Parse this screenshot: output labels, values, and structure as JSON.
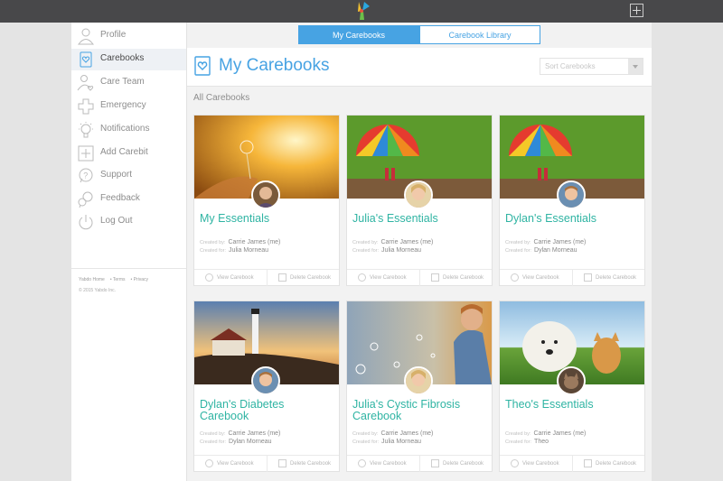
{
  "nav": [
    {
      "label": "Profile",
      "icon": "person-icon"
    },
    {
      "label": "Carebooks",
      "icon": "carebook-icon",
      "active": true
    },
    {
      "label": "Care Team",
      "icon": "care-team-icon"
    },
    {
      "label": "Emergency",
      "icon": "emergency-cross-icon"
    },
    {
      "label": "Notifications",
      "icon": "lightbulb-icon"
    },
    {
      "label": "Add Carebit",
      "icon": "plus-square-icon"
    },
    {
      "label": "Support",
      "icon": "question-bubble-icon"
    },
    {
      "label": "Feedback",
      "icon": "feedback-bubble-icon"
    },
    {
      "label": "Log Out",
      "icon": "power-icon"
    }
  ],
  "footer": {
    "links": [
      "Yabdo Home",
      "Terms",
      "Privacy"
    ],
    "copyright": "© 2015 Yabdo Inc."
  },
  "tabs": [
    "My Carebooks",
    "Carebook Library"
  ],
  "page_title": "My Carebooks",
  "sort": {
    "placeholder": "Sort Carebooks"
  },
  "section_title": "All Carebooks",
  "labels": {
    "created_by": "Created by:",
    "created_for": "Created for:",
    "view": "View Carebook",
    "delete": "Delete Carebook"
  },
  "cards": [
    {
      "title": "My Essentials",
      "created_by": "Carrie James (me)",
      "created_for": "Julia Morneau",
      "image": "dandelion-sunset"
    },
    {
      "title": "Julia's Essentials",
      "created_by": "Carrie James (me)",
      "created_for": "Julia Morneau",
      "image": "child-umbrella"
    },
    {
      "title": "Dylan's Essentials",
      "created_by": "Carrie James (me)",
      "created_for": "Dylan Morneau",
      "image": "child-umbrella"
    },
    {
      "title": "Dylan's Diabetes Carebook",
      "created_by": "Carrie James (me)",
      "created_for": "Dylan Morneau",
      "image": "lighthouse"
    },
    {
      "title": "Julia's Cystic Fibrosis Carebook",
      "created_by": "Carrie James (me)",
      "created_for": "Julia Morneau",
      "image": "bubbles-child"
    },
    {
      "title": "Theo's Essentials",
      "created_by": "Carrie James (me)",
      "created_for": "Theo",
      "image": "dog-and-cat"
    }
  ],
  "colors": {
    "accent": "#47a3e3",
    "title_teal": "#2fb4a3",
    "topbar": "#48484a"
  }
}
